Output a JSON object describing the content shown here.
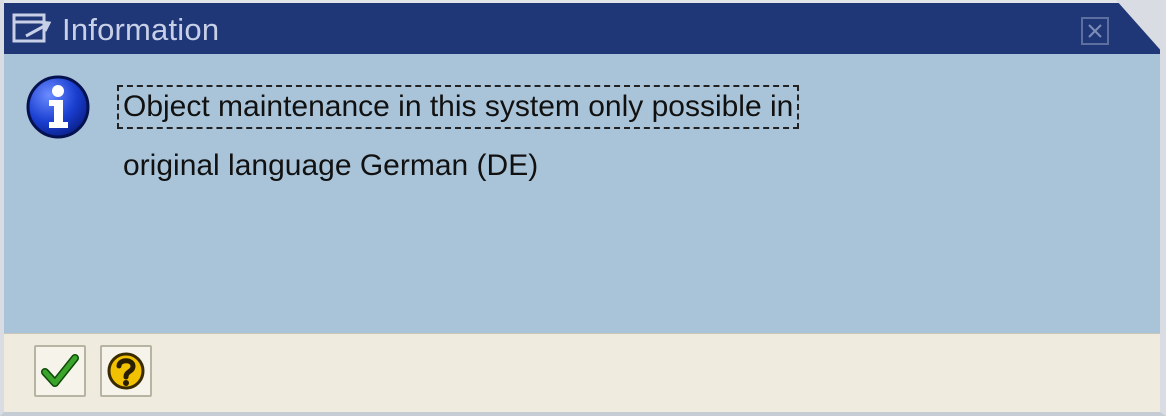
{
  "window": {
    "title": "Information",
    "title_icon": "window-icon",
    "close_icon": "close-icon"
  },
  "message": {
    "icon": "info-icon",
    "line1": "Object maintenance in this system only possible in",
    "line2": "original language German (DE)"
  },
  "footer": {
    "buttons": [
      {
        "name": "continue-button",
        "icon": "checkmark-icon"
      },
      {
        "name": "help-button",
        "icon": "help-icon"
      }
    ]
  },
  "colors": {
    "title_bar": "#1f3677",
    "body": "#a9c4d9",
    "footer": "#efecdf",
    "checkmark": "#2e8b1f",
    "help": "#f2c200",
    "info": "#1a3fd1"
  }
}
